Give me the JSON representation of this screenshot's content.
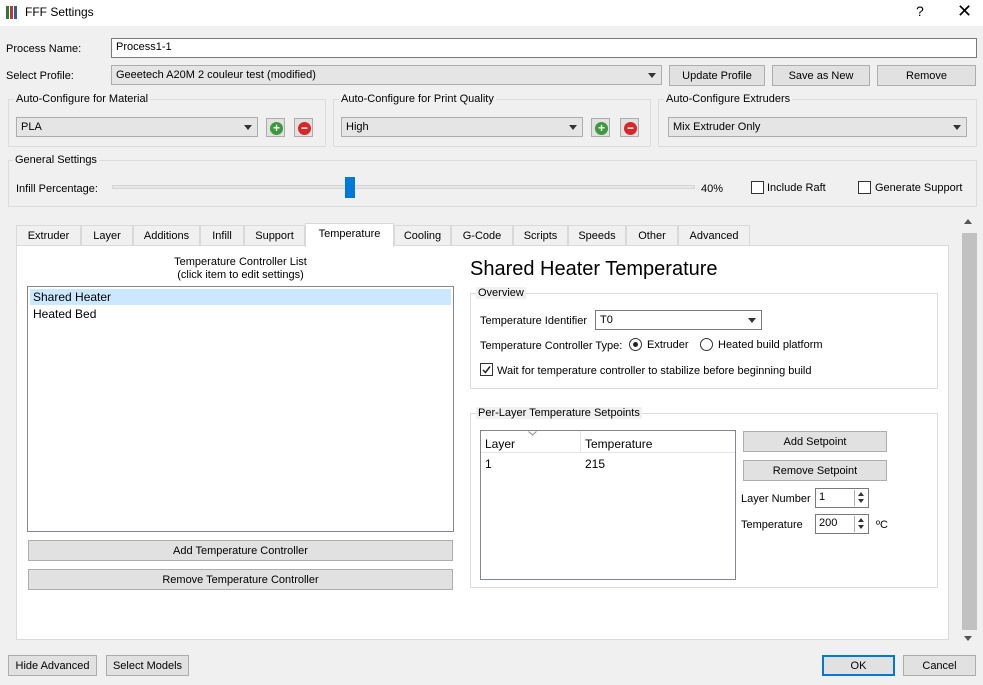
{
  "window": {
    "title": "FFF Settings",
    "help": "?",
    "close": "✕"
  },
  "process": {
    "label": "Process Name:",
    "value": "Process1-1"
  },
  "profile": {
    "label": "Select Profile:",
    "value": "Geeetech A20M 2 couleur test (modified)",
    "update_button": "Update Profile",
    "save_as_button": "Save as New",
    "remove_button": "Remove"
  },
  "auto_material": {
    "title": "Auto-Configure for Material",
    "value": "PLA",
    "add": "+",
    "remove": "−"
  },
  "auto_quality": {
    "title": "Auto-Configure for Print Quality",
    "value": "High",
    "add": "+",
    "remove": "−"
  },
  "auto_extruders": {
    "title": "Auto-Configure Extruders",
    "value": "Mix Extruder Only"
  },
  "general": {
    "title": "General Settings",
    "infill_label": "Infill Percentage:",
    "infill_value": "40%",
    "infill_fraction": 0.4,
    "raft_label": "Include Raft",
    "raft_checked": false,
    "support_label": "Generate Support",
    "support_checked": false
  },
  "tabs": [
    "Extruder",
    "Layer",
    "Additions",
    "Infill",
    "Support",
    "Temperature",
    "Cooling",
    "G-Code",
    "Scripts",
    "Speeds",
    "Other",
    "Advanced"
  ],
  "active_tab": "Temperature",
  "controllers": {
    "heading_line1": "Temperature Controller List",
    "heading_line2": "(click item to edit settings)",
    "items": [
      "Shared Heater",
      "Heated Bed"
    ],
    "selected_index": 0,
    "add_button": "Add Temperature Controller",
    "remove_button": "Remove Temperature Controller"
  },
  "detail": {
    "title": "Shared Heater Temperature",
    "overview": {
      "title": "Overview",
      "identifier_label": "Temperature Identifier",
      "identifier_value": "T0",
      "type_label": "Temperature Controller Type:",
      "type_options": [
        "Extruder",
        "Heated build platform"
      ],
      "type_selected": "Extruder",
      "wait_label": "Wait for temperature controller to stabilize before beginning build",
      "wait_checked": true
    },
    "setpoints": {
      "title": "Per-Layer Temperature Setpoints",
      "columns": [
        "Layer",
        "Temperature"
      ],
      "rows": [
        [
          "1",
          "215"
        ]
      ],
      "add_button": "Add Setpoint",
      "remove_button": "Remove Setpoint",
      "layer_number_label": "Layer Number",
      "layer_number_value": "1",
      "temperature_label": "Temperature",
      "temperature_value": "200",
      "unit": "ºC"
    }
  },
  "footer": {
    "hide_advanced": "Hide Advanced",
    "select_models": "Select Models",
    "ok": "OK",
    "cancel": "Cancel"
  },
  "colors": {
    "accent": "#0078d7",
    "selection": "#cce8ff",
    "add": "#3c9a3c",
    "remove": "#d62828"
  }
}
